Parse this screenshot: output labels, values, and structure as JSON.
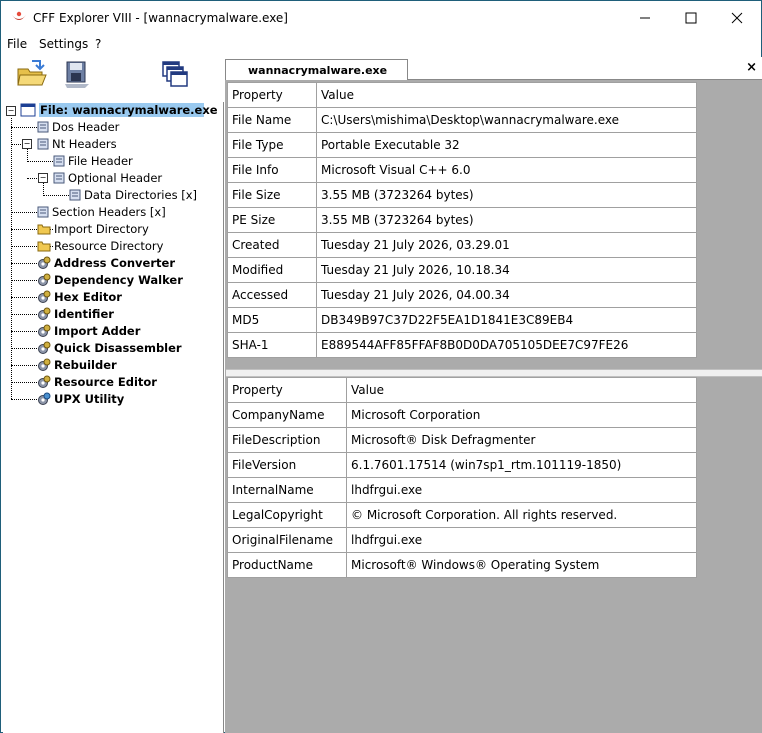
{
  "window": {
    "title": "CFF Explorer VIII - [wannacrymalware.exe]"
  },
  "menu": [
    "File",
    "Settings",
    "?"
  ],
  "tab": {
    "label": "wannacrymalware.exe",
    "close": "×"
  },
  "tree": [
    {
      "label": "File: wannacrymalware.exe",
      "bold": true
    },
    {
      "label": "Dos Header"
    },
    {
      "label": "Nt Headers"
    },
    {
      "label": "File Header"
    },
    {
      "label": "Optional Header"
    },
    {
      "label": "Data Directories [x]"
    },
    {
      "label": "Section Headers [x]"
    },
    {
      "label": "Import Directory"
    },
    {
      "label": "Resource Directory"
    },
    {
      "label": "Address Converter",
      "bold": true
    },
    {
      "label": "Dependency Walker",
      "bold": true
    },
    {
      "label": "Hex Editor",
      "bold": true
    },
    {
      "label": "Identifier",
      "bold": true
    },
    {
      "label": "Import Adder",
      "bold": true
    },
    {
      "label": "Quick Disassembler",
      "bold": true
    },
    {
      "label": "Rebuilder",
      "bold": true
    },
    {
      "label": "Resource Editor",
      "bold": true
    },
    {
      "label": "UPX Utility",
      "bold": true
    }
  ],
  "file_table": {
    "headers": [
      "Property",
      "Value"
    ],
    "rows": [
      [
        "File Name",
        "C:\\Users\\mishima\\Desktop\\wannacrymalware.exe"
      ],
      [
        "File Type",
        "Portable Executable 32"
      ],
      [
        "File Info",
        "Microsoft Visual C++ 6.0"
      ],
      [
        "File Size",
        "3.55 MB (3723264 bytes)"
      ],
      [
        "PE Size",
        "3.55 MB (3723264 bytes)"
      ],
      [
        "Created",
        "Tuesday 21 July 2026, 03.29.01"
      ],
      [
        "Modified",
        "Tuesday 21 July 2026, 10.18.34"
      ],
      [
        "Accessed",
        "Tuesday 21 July 2026, 04.00.34"
      ],
      [
        "MD5",
        "DB349B97C37D22F5EA1D1841E3C89EB4"
      ],
      [
        "SHA-1",
        "E889544AFF85FFAF8B0D0DA705105DEE7C97FE26"
      ]
    ]
  },
  "version_table": {
    "headers": [
      "Property",
      "Value"
    ],
    "rows": [
      [
        "CompanyName",
        "Microsoft Corporation"
      ],
      [
        "FileDescription",
        "Microsoft® Disk Defragmenter"
      ],
      [
        "FileVersion",
        "6.1.7601.17514 (win7sp1_rtm.101119-1850)"
      ],
      [
        "InternalName",
        "lhdfrgui.exe"
      ],
      [
        "LegalCopyright",
        "© Microsoft Corporation. All rights reserved."
      ],
      [
        "OriginalFilename",
        "lhdfrgui.exe"
      ],
      [
        "ProductName",
        "Microsoft® Windows® Operating System"
      ]
    ]
  }
}
